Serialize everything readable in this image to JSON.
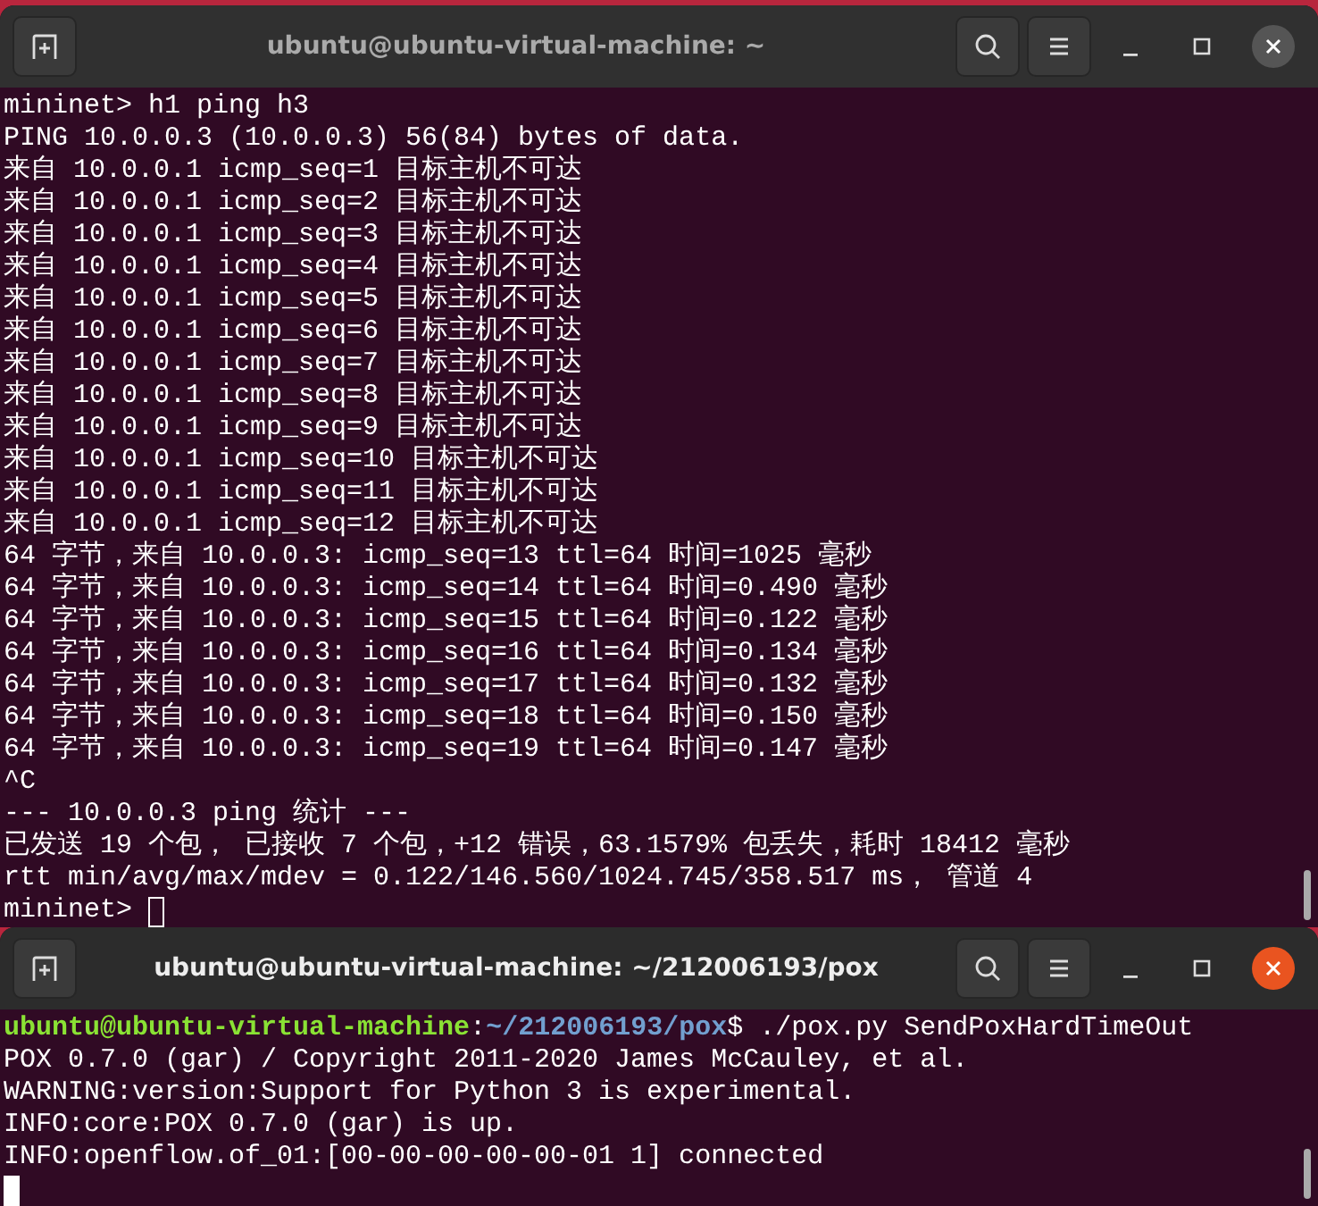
{
  "windows": [
    {
      "title": "ubuntu@ubuntu-virtual-machine: ~",
      "active": false,
      "lines": [
        {
          "kind": "text",
          "text": "mininet> h1 ping h3"
        },
        {
          "kind": "text",
          "text": "PING 10.0.0.3 (10.0.0.3) 56(84) bytes of data."
        },
        {
          "kind": "text",
          "text": "来自 10.0.0.1 icmp_seq=1 目标主机不可达"
        },
        {
          "kind": "text",
          "text": "来自 10.0.0.1 icmp_seq=2 目标主机不可达"
        },
        {
          "kind": "text",
          "text": "来自 10.0.0.1 icmp_seq=3 目标主机不可达"
        },
        {
          "kind": "text",
          "text": "来自 10.0.0.1 icmp_seq=4 目标主机不可达"
        },
        {
          "kind": "text",
          "text": "来自 10.0.0.1 icmp_seq=5 目标主机不可达"
        },
        {
          "kind": "text",
          "text": "来自 10.0.0.1 icmp_seq=6 目标主机不可达"
        },
        {
          "kind": "text",
          "text": "来自 10.0.0.1 icmp_seq=7 目标主机不可达"
        },
        {
          "kind": "text",
          "text": "来自 10.0.0.1 icmp_seq=8 目标主机不可达"
        },
        {
          "kind": "text",
          "text": "来自 10.0.0.1 icmp_seq=9 目标主机不可达"
        },
        {
          "kind": "text",
          "text": "来自 10.0.0.1 icmp_seq=10 目标主机不可达"
        },
        {
          "kind": "text",
          "text": "来自 10.0.0.1 icmp_seq=11 目标主机不可达"
        },
        {
          "kind": "text",
          "text": "来自 10.0.0.1 icmp_seq=12 目标主机不可达"
        },
        {
          "kind": "text",
          "text": "64 字节，来自 10.0.0.3: icmp_seq=13 ttl=64 时间=1025 毫秒"
        },
        {
          "kind": "text",
          "text": "64 字节，来自 10.0.0.3: icmp_seq=14 ttl=64 时间=0.490 毫秒"
        },
        {
          "kind": "text",
          "text": "64 字节，来自 10.0.0.3: icmp_seq=15 ttl=64 时间=0.122 毫秒"
        },
        {
          "kind": "text",
          "text": "64 字节，来自 10.0.0.3: icmp_seq=16 ttl=64 时间=0.134 毫秒"
        },
        {
          "kind": "text",
          "text": "64 字节，来自 10.0.0.3: icmp_seq=17 ttl=64 时间=0.132 毫秒"
        },
        {
          "kind": "text",
          "text": "64 字节，来自 10.0.0.3: icmp_seq=18 ttl=64 时间=0.150 毫秒"
        },
        {
          "kind": "text",
          "text": "64 字节，来自 10.0.0.3: icmp_seq=19 ttl=64 时间=0.147 毫秒"
        },
        {
          "kind": "text",
          "text": "^C"
        },
        {
          "kind": "text",
          "text": "--- 10.0.0.3 ping 统计 ---"
        },
        {
          "kind": "text",
          "text": "已发送 19 个包， 已接收 7 个包，+12 错误，63.1579% 包丢失，耗时 18412 毫秒"
        },
        {
          "kind": "text",
          "text": "rtt min/avg/max/mdev = 0.122/146.560/1024.745/358.517 ms， 管道 4"
        },
        {
          "kind": "input",
          "text": "mininet> "
        }
      ]
    },
    {
      "title": "ubuntu@ubuntu-virtual-machine: ~/212006193/pox",
      "active": true,
      "lines": [
        {
          "kind": "prompt",
          "user": "ubuntu@ubuntu-virtual-machine",
          "separator": ":",
          "path": "~/212006193/pox",
          "command": "$ ./pox.py SendPoxHardTimeOut"
        },
        {
          "kind": "text",
          "text": "POX 0.7.0 (gar) / Copyright 2011-2020 James McCauley, et al."
        },
        {
          "kind": "text",
          "text": "WARNING:version:Support for Python 3 is experimental."
        },
        {
          "kind": "text",
          "text": "INFO:core:POX 0.7.0 (gar) is up."
        },
        {
          "kind": "text",
          "text": "INFO:openflow.of_01:[00-00-00-00-00-01 1] connected"
        },
        {
          "kind": "input"
        }
      ]
    }
  ]
}
